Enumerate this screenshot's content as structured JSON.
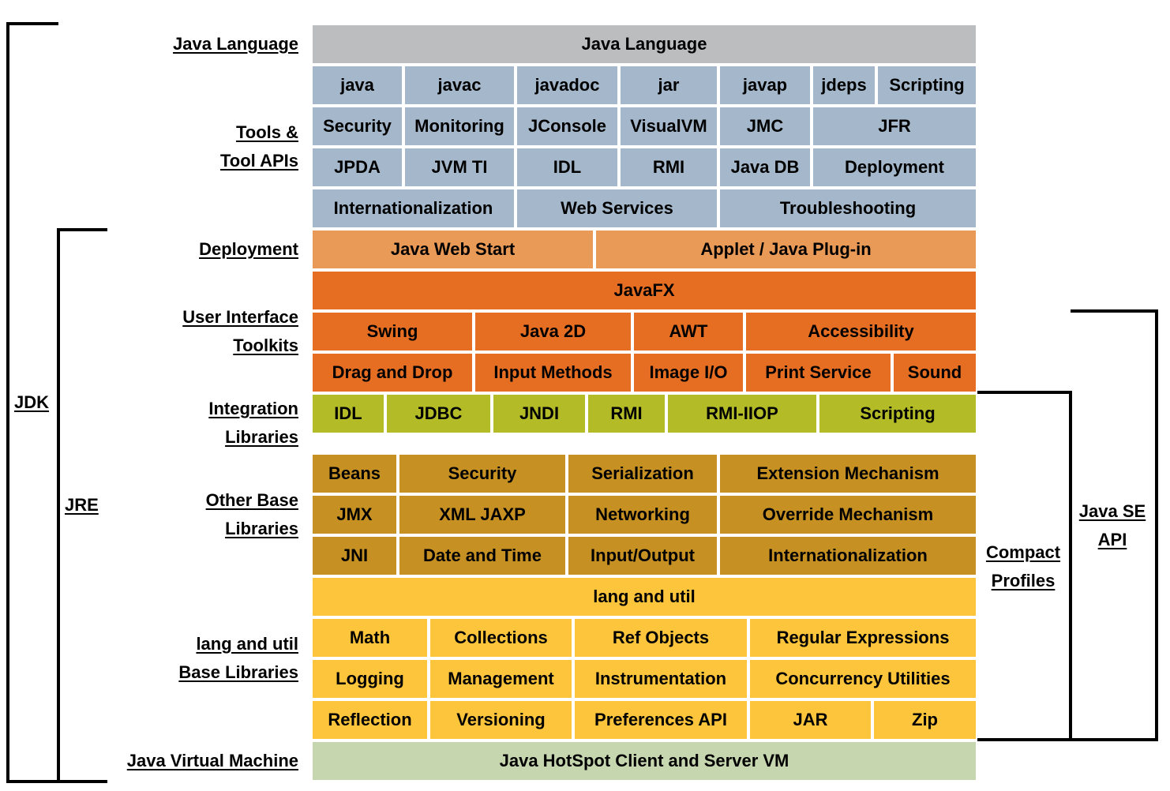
{
  "colors": {
    "java_language": "#bcbdbf",
    "tools": "#a5b8cb",
    "deployment": "#ea9a57",
    "ui_toolkits": "#e56e22",
    "integration": "#b3bb27",
    "other_base": "#c69022",
    "lang_util": "#fdc53c",
    "jvm": "#c6d6af"
  },
  "left_labels": {
    "java_language": "Java Language",
    "tools_line1": "Tools &",
    "tools_line2": "Tool APIs",
    "deployment": "Deployment",
    "ui_line1": "User Interface",
    "ui_line2": "Toolkits",
    "integration_line1": "Integration",
    "integration_line2": "Libraries",
    "other_line1": "Other Base",
    "other_line2": "Libraries",
    "lang_line1": "lang and util",
    "lang_line2": "Base Libraries",
    "jvm": "Java Virtual Machine"
  },
  "brackets": {
    "jdk": "JDK",
    "jre": "JRE",
    "compact_line1": "Compact",
    "compact_line2": "Profiles",
    "javase_line1": "Java SE",
    "javase_line2": "API"
  },
  "rows": [
    {
      "group": "java_language",
      "cells": [
        "Java Language"
      ]
    },
    {
      "group": "tools",
      "cells": [
        "java",
        "javac",
        "javadoc",
        "jar",
        "javap",
        "jdeps",
        "Scripting"
      ]
    },
    {
      "group": "tools",
      "cells": [
        "Security",
        "Monitoring",
        "JConsole",
        "VisualVM",
        "JMC",
        "JFR"
      ]
    },
    {
      "group": "tools",
      "cells": [
        "JPDA",
        "JVM TI",
        "IDL",
        "RMI",
        "Java DB",
        "Deployment"
      ]
    },
    {
      "group": "tools",
      "cells": [
        "Internationalization",
        "Web Services",
        "Troubleshooting"
      ]
    },
    {
      "group": "deployment",
      "cells": [
        "Java Web Start",
        "Applet / Java Plug-in"
      ]
    },
    {
      "group": "ui_toolkits",
      "cells": [
        "JavaFX"
      ]
    },
    {
      "group": "ui_toolkits",
      "cells": [
        "Swing",
        "Java 2D",
        "AWT",
        "Accessibility"
      ]
    },
    {
      "group": "ui_toolkits",
      "cells": [
        "Drag and Drop",
        "Input Methods",
        "Image I/O",
        "Print Service",
        "Sound"
      ]
    },
    {
      "group": "integration",
      "cells": [
        "IDL",
        "JDBC",
        "JNDI",
        "RMI",
        "RMI-IIOP",
        "Scripting"
      ]
    },
    {
      "group": "other_base",
      "cells": [
        "Beans",
        "Security",
        "Serialization",
        "Extension Mechanism"
      ]
    },
    {
      "group": "other_base",
      "cells": [
        "JMX",
        "XML JAXP",
        "Networking",
        "Override Mechanism"
      ]
    },
    {
      "group": "other_base",
      "cells": [
        "JNI",
        "Date and Time",
        "Input/Output",
        "Internationalization"
      ]
    },
    {
      "group": "lang_util",
      "cells": [
        "lang and util"
      ]
    },
    {
      "group": "lang_util",
      "cells": [
        "Math",
        "Collections",
        "Ref Objects",
        "Regular Expressions"
      ]
    },
    {
      "group": "lang_util",
      "cells": [
        "Logging",
        "Management",
        "Instrumentation",
        "Concurrency Utilities"
      ]
    },
    {
      "group": "lang_util",
      "cells": [
        "Reflection",
        "Versioning",
        "Preferences API",
        "JAR",
        "Zip"
      ]
    },
    {
      "group": "jvm",
      "cells": [
        "Java HotSpot Client and Server VM"
      ]
    }
  ]
}
